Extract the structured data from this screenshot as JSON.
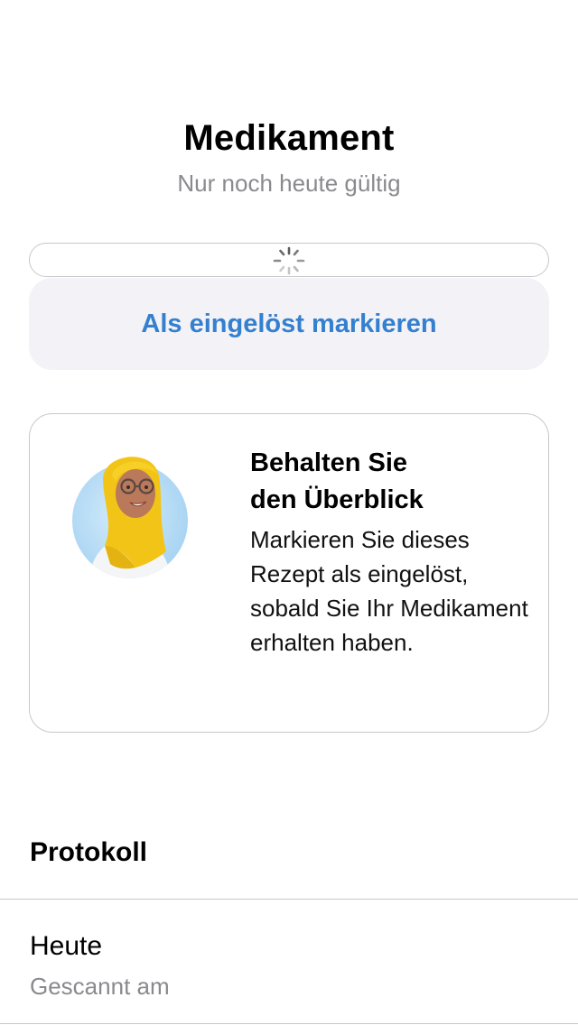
{
  "header": {
    "title": "Medikament",
    "subtitle": "Nur noch heute gültig"
  },
  "actions": {
    "mark_redeemed_label": "Als eingelöst markieren"
  },
  "info_card": {
    "title_line1": "Behalten Sie",
    "title_line2": "den Überblick",
    "body": "Markieren Sie dieses Rezept als eingelöst, sobald Sie Ihr Medikament erhalten haben.",
    "avatar_icon": "avatar-woman-yellow-hijab"
  },
  "protocol": {
    "title": "Protokoll",
    "entries": [
      {
        "day": "Heute",
        "description": "Gescannt am"
      }
    ]
  },
  "colors": {
    "accent": "#3480cf",
    "button_bg": "#f2f2f7",
    "secondary_text": "#8a8a8e",
    "border": "#c8c8cc"
  }
}
